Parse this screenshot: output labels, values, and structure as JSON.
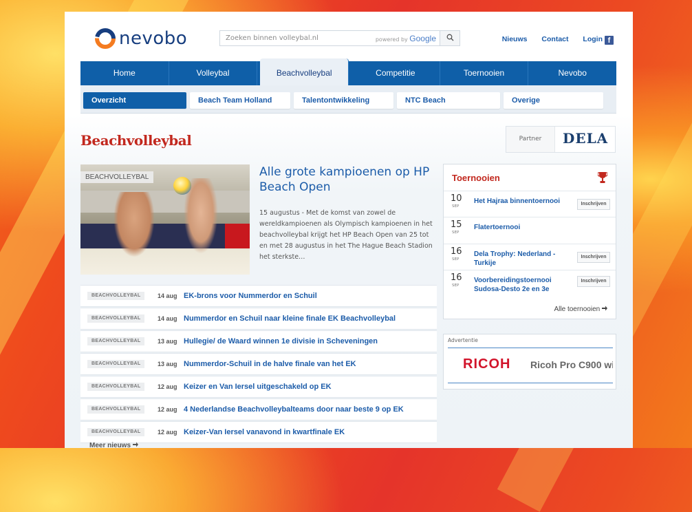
{
  "brand": {
    "name": "nevobo"
  },
  "search": {
    "placeholder": "Zoeken binnen volleybal.nl",
    "powered_by": "powered by",
    "provider": "Google"
  },
  "toplinks": {
    "news": "Nieuws",
    "contact": "Contact",
    "login": "Login",
    "facebook": "f"
  },
  "mainnav": [
    "Home",
    "Volleybal",
    "Beachvolleybal",
    "Competitie",
    "Toernooien",
    "Nevobo"
  ],
  "mainnav_active": "Beachvolleybal",
  "subnav": [
    "Overzicht",
    "Beach Team Holland",
    "Talentontwikkeling",
    "NTC Beach",
    "Overige"
  ],
  "subnav_active": "Overzicht",
  "page_title": "Beachvolleybal",
  "partner": {
    "label": "Partner",
    "name": "DELA"
  },
  "feature": {
    "tag": "BEACHVOLLEYBAL",
    "title": "Alle grote kampioenen op HP Beach Open",
    "body": "15 augustus - Met de komst van zowel de wereldkampioenen als Olympisch kampioenen in het beachvolleybal krijgt het HP Beach Open van 25 tot en met 28 augustus in het The Hague Beach Stadion het sterkste…"
  },
  "news": [
    {
      "tag": "BEACHVOLLEYBAL",
      "date": "14 aug",
      "title": "EK-brons voor Nummerdor en Schuil"
    },
    {
      "tag": "BEACHVOLLEYBAL",
      "date": "14 aug",
      "title": "Nummerdor en Schuil naar kleine finale EK Beachvolleybal"
    },
    {
      "tag": "BEACHVOLLEYBAL",
      "date": "13 aug",
      "title": "Hullegie/ de Waard winnen 1e divisie in Scheveningen"
    },
    {
      "tag": "BEACHVOLLEYBAL",
      "date": "13 aug",
      "title": "Nummerdor-Schuil in de halve finale van het EK"
    },
    {
      "tag": "BEACHVOLLEYBAL",
      "date": "12 aug",
      "title": "Keizer en Van Iersel uitgeschakeld op EK"
    },
    {
      "tag": "BEACHVOLLEYBAL",
      "date": "12 aug",
      "title": "4 Nederlandse Beachvolleybalteams door naar beste 9 op EK"
    },
    {
      "tag": "BEACHVOLLEYBAL",
      "date": "12 aug",
      "title": "Keizer-Van Iersel vanavond in kwartfinale EK"
    }
  ],
  "more_news": "Meer nieuws",
  "tournaments": {
    "title": "Toernooien",
    "items": [
      {
        "day": "10",
        "month": "SEP",
        "name": "Het Hajraa binnentoernooi",
        "button": "Inschrijven"
      },
      {
        "day": "15",
        "month": "SEP",
        "name": "Flatertoernooi",
        "button": ""
      },
      {
        "day": "16",
        "month": "SEP",
        "name": "Dela Trophy: Nederland - Turkije",
        "button": "Inschrijven"
      },
      {
        "day": "16",
        "month": "SEP",
        "name": "Voorbereidingstoernooi Sudosa-Desto 2e en 3e",
        "button": "Inschrijven"
      }
    ],
    "all_link": "Alle toernooien"
  },
  "ad": {
    "label": "Advertentie",
    "brand": "RICOH",
    "text": "Ricoh Pro C900 wi"
  },
  "colors": {
    "nav_blue": "#0f5fa8",
    "title_red": "#c2281e",
    "link_blue": "#1c5ca9"
  }
}
